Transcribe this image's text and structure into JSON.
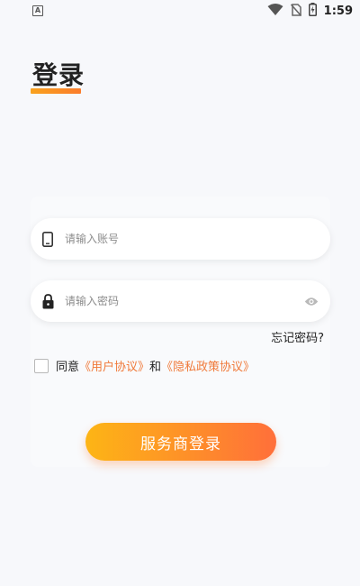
{
  "status_bar": {
    "left_icon": "a-icon",
    "icons": [
      "wifi-icon",
      "no-sim-icon",
      "battery-charging-icon"
    ],
    "time": "1:59"
  },
  "page": {
    "title": "登录",
    "accent_color": "#fb8a26"
  },
  "form": {
    "account_placeholder": "请输入账号",
    "account_icon": "phone-icon",
    "password_placeholder": "请输入密码",
    "password_icon": "lock-icon",
    "password_toggle_icon": "eye-icon",
    "forgot_label": "忘记密码?",
    "agree_prefix": "同意",
    "user_agreement": "《用户协议》",
    "conjunction": "和",
    "privacy_policy": "《隐私政策协议》",
    "agree_checked": false,
    "submit_label": "服务商登录"
  }
}
